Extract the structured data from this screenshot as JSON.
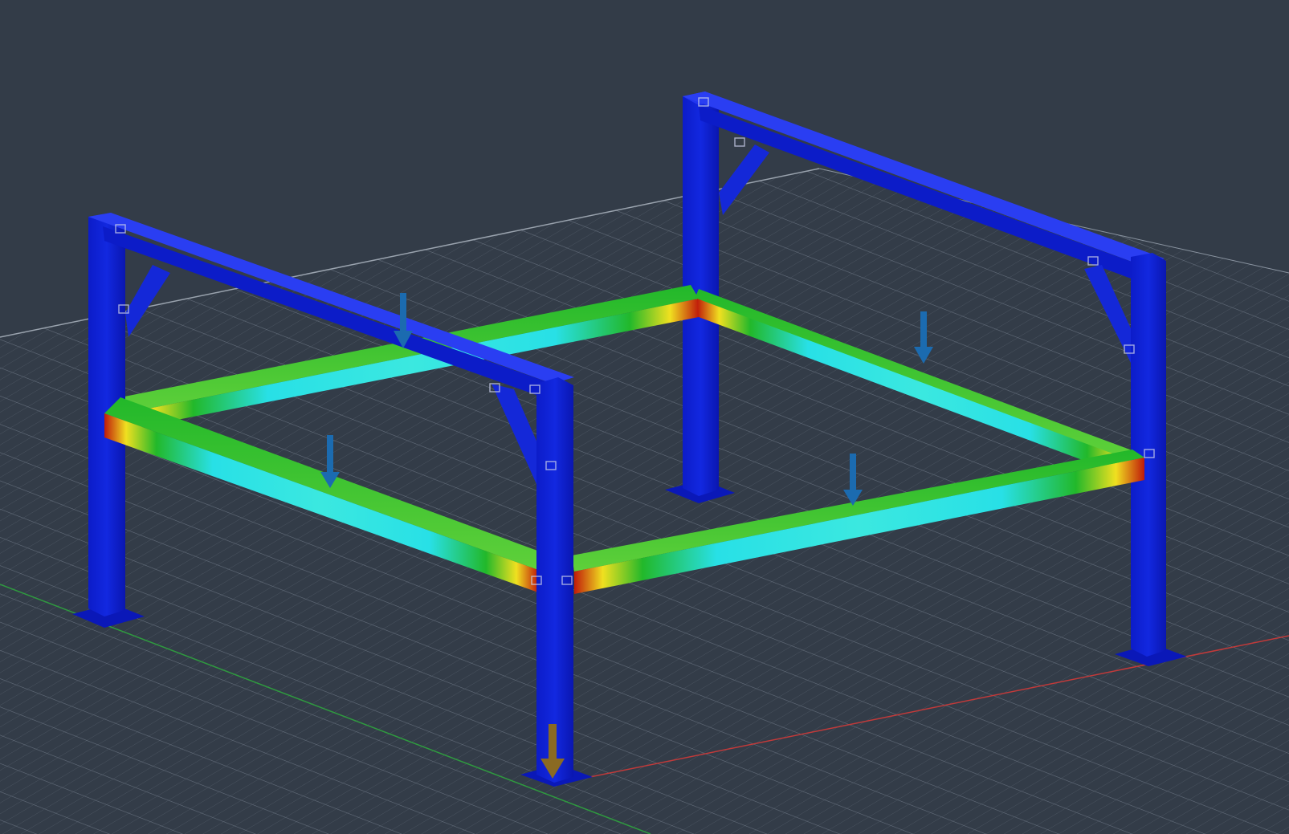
{
  "scene": {
    "view": "isometric",
    "background_color": "#333c48",
    "grid_color": "#6c7684",
    "axis_colors": {
      "x_axis": "#c23a3a",
      "y_axis": "#2f9a3f"
    }
  },
  "model": {
    "frames": [
      {
        "name": "left-portal-frame",
        "posts": 2,
        "crossbeam": true,
        "knee_braces": 2
      },
      {
        "name": "right-portal-frame",
        "posts": 2,
        "crossbeam": true,
        "knee_braces": 2
      }
    ],
    "perimeter_beams": [
      "front-left",
      "front-right",
      "back-left",
      "back-right"
    ],
    "base_plates": 4,
    "stress_colormap": [
      "#0a18d6",
      "#1e6ef0",
      "#28e0e6",
      "#22b82a",
      "#f0e020",
      "#e08a10",
      "#c01a0a"
    ]
  },
  "loads": [
    {
      "name": "load-arrow-back-left",
      "color": "#1b6bb0",
      "direction": "down"
    },
    {
      "name": "load-arrow-front-left",
      "color": "#1b6bb0",
      "direction": "down"
    },
    {
      "name": "load-arrow-back-right",
      "color": "#1b6bb0",
      "direction": "down"
    },
    {
      "name": "load-arrow-front-right",
      "color": "#1b6bb0",
      "direction": "down"
    },
    {
      "name": "gravity-arrow",
      "color": "#8a6a22",
      "direction": "down"
    }
  ]
}
